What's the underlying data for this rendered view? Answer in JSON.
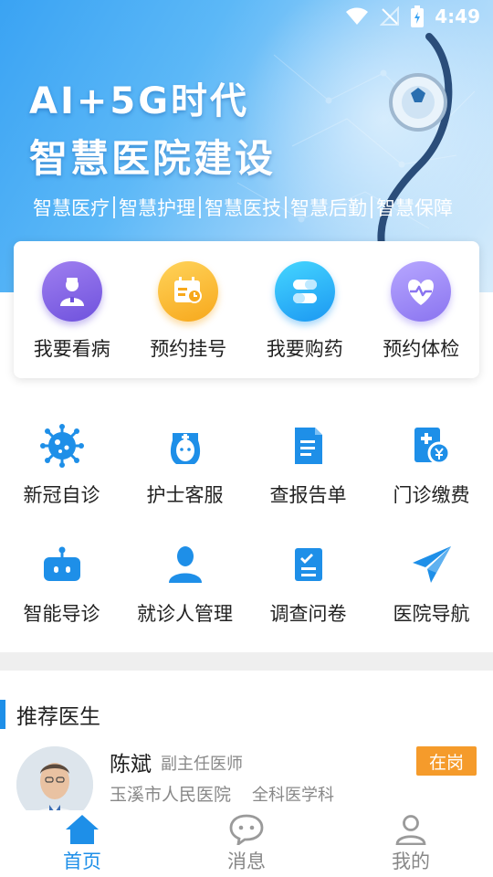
{
  "status_bar": {
    "time": "4:49"
  },
  "banner": {
    "line1": "AI+5G时代",
    "line2": "智慧医院建设",
    "tags": [
      "智慧医疗",
      "智慧护理",
      "智慧医技",
      "智慧后勤",
      "智慧保障"
    ]
  },
  "quick_actions": [
    {
      "label": "我要看病",
      "icon": "doctor-icon"
    },
    {
      "label": "预约挂号",
      "icon": "calendar-icon"
    },
    {
      "label": "我要购药",
      "icon": "pill-icon"
    },
    {
      "label": "预约体检",
      "icon": "heart-pulse-icon"
    }
  ],
  "services": [
    {
      "label": "新冠自诊",
      "icon": "virus-icon"
    },
    {
      "label": "护士客服",
      "icon": "nurse-icon"
    },
    {
      "label": "查报告单",
      "icon": "report-icon"
    },
    {
      "label": "门诊缴费",
      "icon": "payment-icon"
    },
    {
      "label": "智能导诊",
      "icon": "robot-icon"
    },
    {
      "label": "就诊人管理",
      "icon": "user-icon"
    },
    {
      "label": "调查问卷",
      "icon": "survey-icon"
    },
    {
      "label": "医院导航",
      "icon": "paper-plane-icon"
    }
  ],
  "recommended": {
    "title": "推荐医生",
    "doctor": {
      "name": "陈斌",
      "title": "副主任医师",
      "hospital": "玉溪市人民医院",
      "department": "全科医学科",
      "status": "在岗"
    }
  },
  "bottom_nav": [
    {
      "label": "首页",
      "icon": "home-icon",
      "active": true
    },
    {
      "label": "消息",
      "icon": "chat-icon",
      "active": false
    },
    {
      "label": "我的",
      "icon": "profile-icon",
      "active": false
    }
  ],
  "colors": {
    "primary": "#1e8fe8",
    "status_badge": "#f59b2b",
    "service_icon": "#1e8fe8"
  }
}
